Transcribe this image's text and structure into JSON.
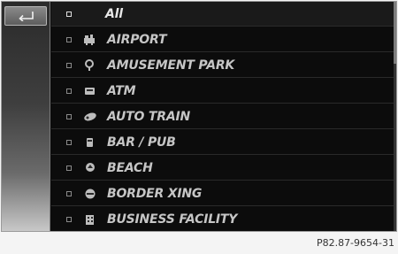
{
  "header": {
    "label": "All"
  },
  "back_icon": "back-arrow-icon",
  "items": [
    {
      "label": "AIRPORT",
      "icon": "airport-icon"
    },
    {
      "label": "AMUSEMENT PARK",
      "icon": "amusement-park-icon"
    },
    {
      "label": "ATM",
      "icon": "atm-icon"
    },
    {
      "label": "AUTO TRAIN",
      "icon": "auto-train-icon"
    },
    {
      "label": "BAR / PUB",
      "icon": "bar-pub-icon"
    },
    {
      "label": "BEACH",
      "icon": "beach-icon"
    },
    {
      "label": "BORDER XING",
      "icon": "border-crossing-icon"
    },
    {
      "label": "BUSINESS FACILITY",
      "icon": "business-facility-icon"
    }
  ],
  "caption": "P82.87-9654-31"
}
